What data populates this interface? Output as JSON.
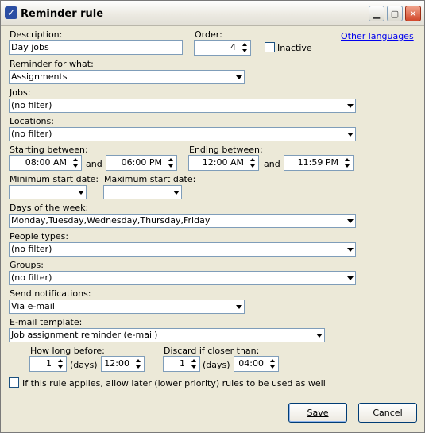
{
  "window": {
    "title": "Reminder rule"
  },
  "labels": {
    "description": "Description:",
    "order": "Order:",
    "inactive": "Inactive",
    "other_languages": "Other languages",
    "reminder_for_what": "Reminder for what:",
    "jobs": "Jobs:",
    "locations": "Locations:",
    "starting_between": "Starting between:",
    "and1": "and",
    "ending_between": "Ending between:",
    "and2": "and",
    "min_start_date": "Minimum start date:",
    "max_start_date": "Maximum start date:",
    "days_of_week": "Days of the week:",
    "people_types": "People types:",
    "groups": "Groups:",
    "send_notifications": "Send notifications:",
    "email_template": "E-mail template:",
    "how_long_before": "How long before:",
    "days1": "(days)",
    "discard_if_closer": "Discard if closer than:",
    "days2": "(days)",
    "allow_later_rules": "If this rule applies, allow later (lower priority) rules to be used as well"
  },
  "fields": {
    "description": "Day jobs",
    "order": "4",
    "reminder_for_what": "Assignments",
    "jobs": "(no filter)",
    "locations": "(no filter)",
    "start_from": "08:00 AM",
    "start_to": "06:00 PM",
    "end_from": "12:00 AM",
    "end_to": "11:59 PM",
    "min_start_date": "",
    "max_start_date": "",
    "days_of_week": "Monday,Tuesday,Wednesday,Thursday,Friday",
    "people_types": "(no filter)",
    "groups": "(no filter)",
    "send_notifications": "Via e-mail",
    "email_template": "Job assignment reminder (e-mail)",
    "how_long_days": "1",
    "how_long_time": "12:00",
    "discard_days": "1",
    "discard_time": "04:00"
  },
  "checkboxes": {
    "inactive": false,
    "allow_later_rules": false
  },
  "buttons": {
    "save": "Save",
    "cancel": "Cancel"
  }
}
